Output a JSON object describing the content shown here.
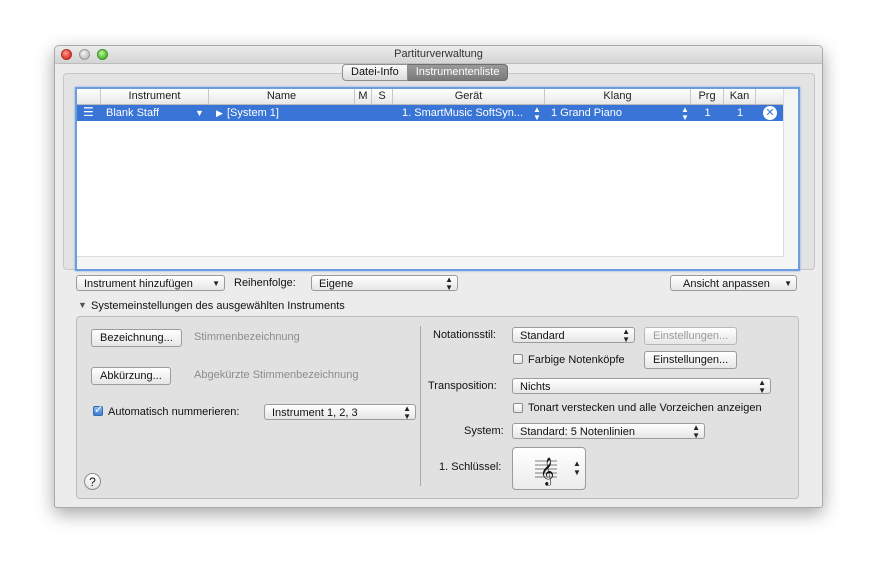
{
  "window": {
    "title": "Partiturverwaltung"
  },
  "tabs": [
    {
      "label": "Datei-Info",
      "active": false
    },
    {
      "label": "Instrumentenliste",
      "active": true
    }
  ],
  "table": {
    "columns": [
      "Instrument",
      "Name",
      "M",
      "S",
      "Gerät",
      "Klang",
      "Prg",
      "Kan"
    ],
    "rows": [
      {
        "instrument": "Blank Staff",
        "name": "[System 1]",
        "geraet": "1. SmartMusic SoftSyn...",
        "klang": "1 Grand Piano",
        "prg": "1",
        "kan": "1"
      }
    ]
  },
  "toolbar": {
    "add_instrument": "Instrument hinzufügen",
    "order_label": "Reihenfolge:",
    "order_value": "Eigene",
    "adjust_view": "Ansicht anpassen"
  },
  "section": {
    "title": "Systemeinstellungen des ausgewählten Instruments",
    "bezeichnung_button": "Bezeichnung...",
    "bezeichnung_label": "Stimmenbezeichnung",
    "abkuerzung_button": "Abkürzung...",
    "abkuerzung_label": "Abgekürzte Stimmenbezeichnung",
    "auto_number_label": "Automatisch nummerieren:",
    "auto_number_checked": true,
    "auto_number_value": "Instrument 1, 2, 3",
    "notationsstil_label": "Notationsstil:",
    "notationsstil_value": "Standard",
    "einstellungen_disabled": "Einstellungen...",
    "farbige_label": "Farbige Notenköpfe",
    "einstellungen": "Einstellungen...",
    "transposition_label": "Transposition:",
    "transposition_value": "Nichts",
    "tonart_label": "Tonart verstecken und alle Vorzeichen anzeigen",
    "system_label": "System:",
    "system_value": "Standard: 5 Notenlinien",
    "schluessel_label": "1. Schlüssel:"
  },
  "help": "?"
}
